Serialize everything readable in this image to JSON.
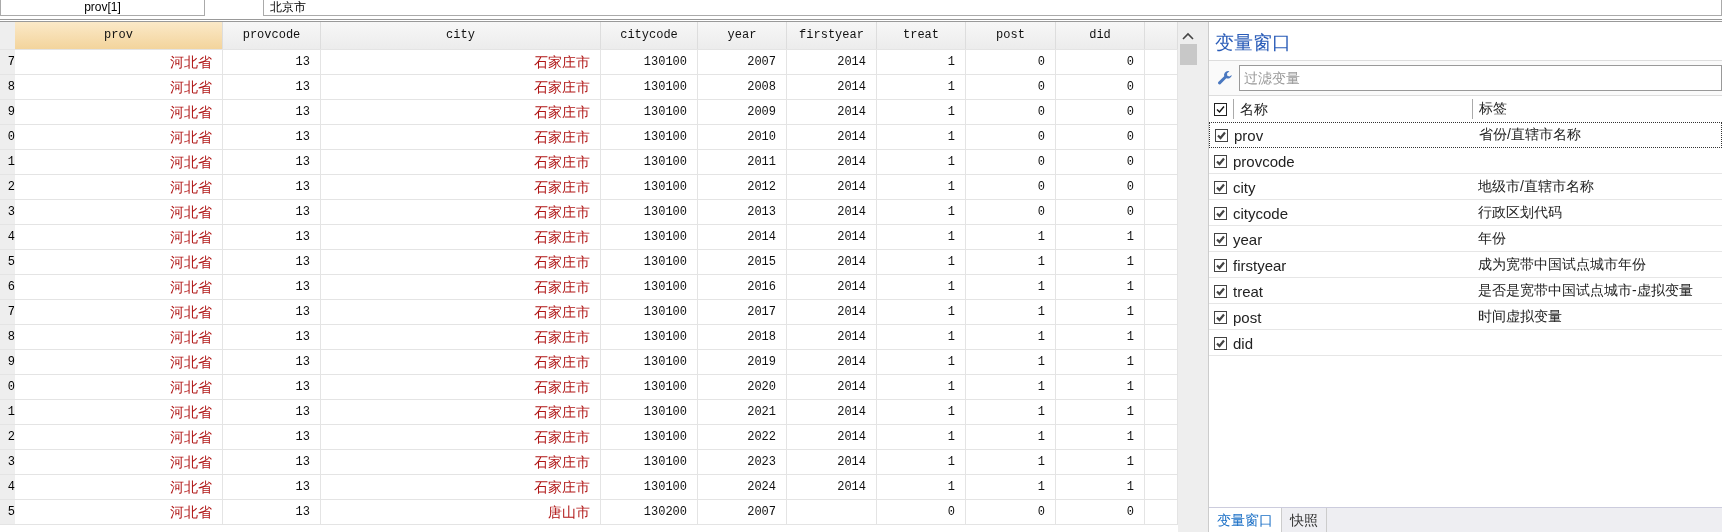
{
  "top_bar": {
    "variable": "prov[1]",
    "value": "北京市"
  },
  "grid": {
    "columns": [
      {
        "label": "prov",
        "kind": "string",
        "selected": true
      },
      {
        "label": "provcode",
        "kind": "numeric",
        "selected": false
      },
      {
        "label": "city",
        "kind": "string",
        "selected": false
      },
      {
        "label": "citycode",
        "kind": "numeric",
        "selected": false
      },
      {
        "label": "year",
        "kind": "numeric",
        "selected": false
      },
      {
        "label": "firstyear",
        "kind": "numeric",
        "selected": false
      },
      {
        "label": "treat",
        "kind": "numeric",
        "selected": false
      },
      {
        "label": "post",
        "kind": "numeric",
        "selected": false
      },
      {
        "label": "did",
        "kind": "numeric",
        "selected": false
      }
    ],
    "rows": [
      {
        "row_number": "7",
        "cells": [
          "河北省",
          "13",
          "石家庄市",
          "130100",
          "2007",
          "2014",
          "1",
          "0",
          "0"
        ]
      },
      {
        "row_number": "8",
        "cells": [
          "河北省",
          "13",
          "石家庄市",
          "130100",
          "2008",
          "2014",
          "1",
          "0",
          "0"
        ]
      },
      {
        "row_number": "9",
        "cells": [
          "河北省",
          "13",
          "石家庄市",
          "130100",
          "2009",
          "2014",
          "1",
          "0",
          "0"
        ]
      },
      {
        "row_number": "0",
        "cells": [
          "河北省",
          "13",
          "石家庄市",
          "130100",
          "2010",
          "2014",
          "1",
          "0",
          "0"
        ]
      },
      {
        "row_number": "1",
        "cells": [
          "河北省",
          "13",
          "石家庄市",
          "130100",
          "2011",
          "2014",
          "1",
          "0",
          "0"
        ]
      },
      {
        "row_number": "2",
        "cells": [
          "河北省",
          "13",
          "石家庄市",
          "130100",
          "2012",
          "2014",
          "1",
          "0",
          "0"
        ]
      },
      {
        "row_number": "3",
        "cells": [
          "河北省",
          "13",
          "石家庄市",
          "130100",
          "2013",
          "2014",
          "1",
          "0",
          "0"
        ]
      },
      {
        "row_number": "4",
        "cells": [
          "河北省",
          "13",
          "石家庄市",
          "130100",
          "2014",
          "2014",
          "1",
          "1",
          "1"
        ]
      },
      {
        "row_number": "5",
        "cells": [
          "河北省",
          "13",
          "石家庄市",
          "130100",
          "2015",
          "2014",
          "1",
          "1",
          "1"
        ]
      },
      {
        "row_number": "6",
        "cells": [
          "河北省",
          "13",
          "石家庄市",
          "130100",
          "2016",
          "2014",
          "1",
          "1",
          "1"
        ]
      },
      {
        "row_number": "7",
        "cells": [
          "河北省",
          "13",
          "石家庄市",
          "130100",
          "2017",
          "2014",
          "1",
          "1",
          "1"
        ]
      },
      {
        "row_number": "8",
        "cells": [
          "河北省",
          "13",
          "石家庄市",
          "130100",
          "2018",
          "2014",
          "1",
          "1",
          "1"
        ]
      },
      {
        "row_number": "9",
        "cells": [
          "河北省",
          "13",
          "石家庄市",
          "130100",
          "2019",
          "2014",
          "1",
          "1",
          "1"
        ]
      },
      {
        "row_number": "0",
        "cells": [
          "河北省",
          "13",
          "石家庄市",
          "130100",
          "2020",
          "2014",
          "1",
          "1",
          "1"
        ]
      },
      {
        "row_number": "1",
        "cells": [
          "河北省",
          "13",
          "石家庄市",
          "130100",
          "2021",
          "2014",
          "1",
          "1",
          "1"
        ]
      },
      {
        "row_number": "2",
        "cells": [
          "河北省",
          "13",
          "石家庄市",
          "130100",
          "2022",
          "2014",
          "1",
          "1",
          "1"
        ]
      },
      {
        "row_number": "3",
        "cells": [
          "河北省",
          "13",
          "石家庄市",
          "130100",
          "2023",
          "2014",
          "1",
          "1",
          "1"
        ]
      },
      {
        "row_number": "4",
        "cells": [
          "河北省",
          "13",
          "石家庄市",
          "130100",
          "2024",
          "2014",
          "1",
          "1",
          "1"
        ]
      },
      {
        "row_number": "5",
        "cells": [
          "河北省",
          "13",
          "唐山市",
          "130200",
          "2007",
          null,
          "0",
          "0",
          "0"
        ]
      }
    ]
  },
  "variables_panel": {
    "title": "变量窗口",
    "filter": {
      "placeholder": "过滤变量"
    },
    "header": {
      "checked": true,
      "columns": [
        "名称",
        "标签"
      ]
    },
    "items": [
      {
        "name": "prov",
        "label": "省份/直辖市名称",
        "checked": true,
        "selected": true
      },
      {
        "name": "provcode",
        "checked": true,
        "selected": false
      },
      {
        "name": "city",
        "label": "地级市/直辖市名称",
        "checked": true,
        "selected": false
      },
      {
        "name": "citycode",
        "label": "行政区划代码",
        "checked": true,
        "selected": false
      },
      {
        "name": "year",
        "label": "年份",
        "checked": true,
        "selected": false
      },
      {
        "name": "firstyear",
        "label": "成为宽带中国试点城市年份",
        "checked": true,
        "selected": false
      },
      {
        "name": "treat",
        "label": "是否是宽带中国试点城市-虚拟变量",
        "checked": true,
        "selected": false
      },
      {
        "name": "post",
        "label": "时间虚拟变量",
        "checked": true,
        "selected": false
      },
      {
        "name": "did",
        "checked": true,
        "selected": false
      }
    ],
    "tabs": [
      {
        "label": "变量窗口",
        "selected": true
      },
      {
        "label": "快照",
        "selected": false
      }
    ]
  }
}
